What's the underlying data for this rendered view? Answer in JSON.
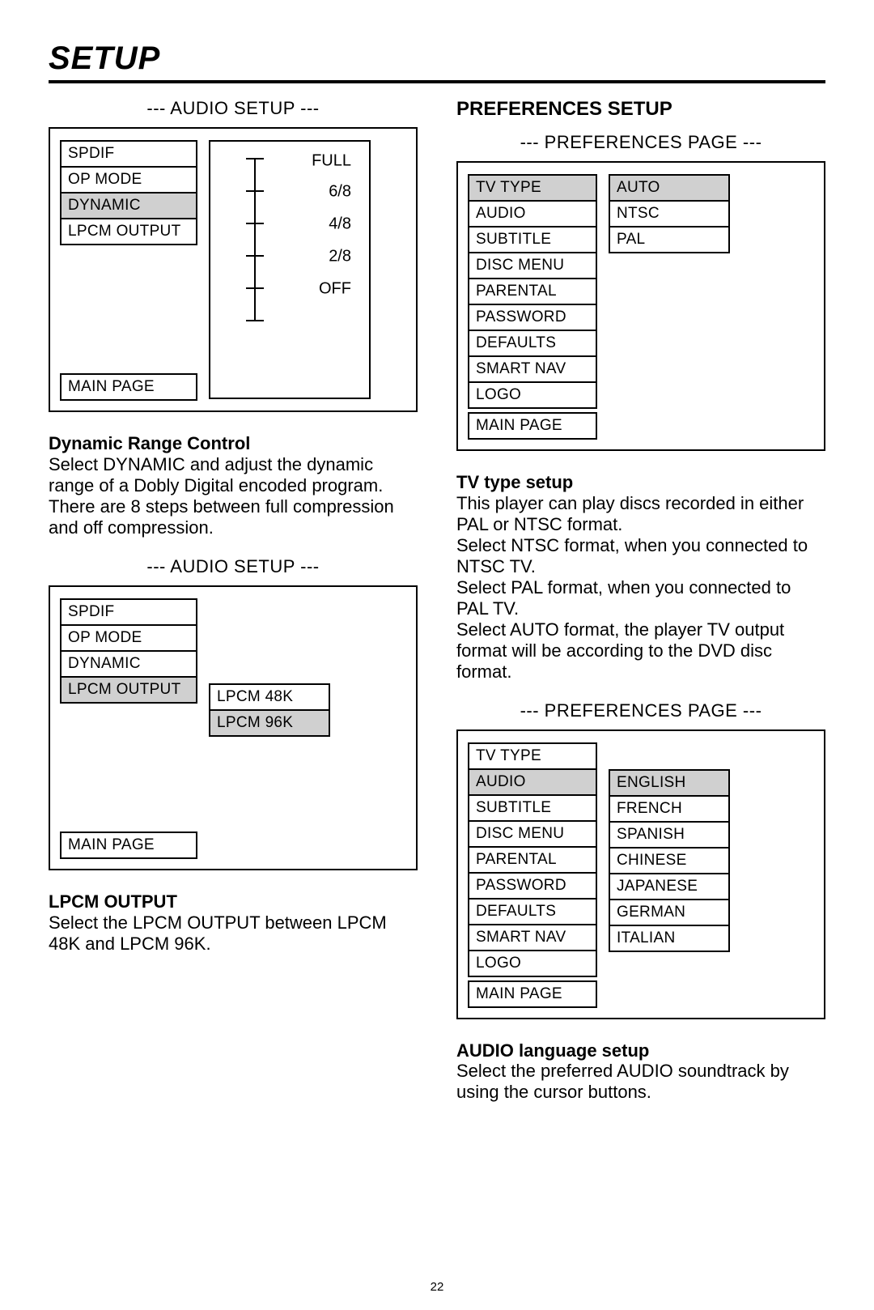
{
  "page_title": "SETUP",
  "page_number": "22",
  "left": {
    "audio_setup_title": "--- AUDIO SETUP ---",
    "menu1": {
      "items": [
        "SPDIF",
        "OP MODE",
        "DYNAMIC",
        "LPCM OUTPUT"
      ],
      "selected": "DYNAMIC",
      "main_page": "MAIN PAGE",
      "slider_labels": [
        "FULL",
        "6/8",
        "4/8",
        "2/8",
        "OFF"
      ]
    },
    "drc_title": "Dynamic Range Control",
    "drc_body": "Select DYNAMIC and adjust the dynamic range of a Dobly Digital encoded program.  There are 8 steps between full compression and off compression.",
    "menu2": {
      "items": [
        "SPDIF",
        "OP MODE",
        "DYNAMIC",
        "LPCM OUTPUT"
      ],
      "selected": "LPCM OUTPUT",
      "main_page": "MAIN PAGE",
      "options": [
        "LPCM 48K",
        "LPCM 96K"
      ],
      "options_selected": "LPCM 96K"
    },
    "lpcm_title": "LPCM OUTPUT",
    "lpcm_body": "Select the LPCM OUTPUT between LPCM 48K and LPCM 96K."
  },
  "right": {
    "pref_setup_heading": "PREFERENCES SETUP",
    "pref_page_title": "--- PREFERENCES PAGE ---",
    "menu1": {
      "items": [
        "TV TYPE",
        "AUDIO",
        "SUBTITLE",
        "DISC MENU",
        "PARENTAL",
        "PASSWORD",
        "DEFAULTS",
        "SMART NAV",
        "LOGO",
        "MAIN PAGE"
      ],
      "selected": "TV TYPE",
      "options": [
        "AUTO",
        "NTSC",
        "PAL"
      ],
      "options_selected": "AUTO"
    },
    "tv_title": "TV type setup",
    "tv_body": "This player can play discs recorded in either PAL or NTSC format.\nSelect NTSC format, when you connected to NTSC TV.\nSelect PAL format, when you connected to PAL TV.\nSelect AUTO format, the player TV output format will be according to the DVD disc format.",
    "menu2": {
      "items": [
        "TV TYPE",
        "AUDIO",
        "SUBTITLE",
        "DISC MENU",
        "PARENTAL",
        "PASSWORD",
        "DEFAULTS",
        "SMART NAV",
        "LOGO",
        "MAIN PAGE"
      ],
      "selected": "AUDIO",
      "options": [
        "ENGLISH",
        "FRENCH",
        "SPANISH",
        "CHINESE",
        "JAPANESE",
        "GERMAN",
        "ITALIAN"
      ],
      "options_selected": "ENGLISH"
    },
    "audio_title": "AUDIO language setup",
    "audio_body": "Select the preferred AUDIO soundtrack by using the cursor buttons."
  }
}
